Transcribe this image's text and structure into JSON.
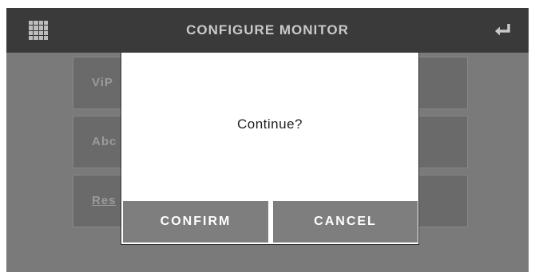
{
  "header": {
    "title": "CONFIGURE MONITOR",
    "menu_icon": "grid-menu-icon",
    "back_icon": "return-arrow-icon"
  },
  "menu": {
    "items": [
      {
        "label": "ViP"
      },
      {
        "label": "Abc"
      },
      {
        "label": "Res"
      }
    ]
  },
  "dialog": {
    "message": "Continue?",
    "confirm_label": "CONFIRM",
    "cancel_label": "CANCEL"
  },
  "colors": {
    "background": "#7a7a7a",
    "header": "#3a3a3a",
    "button": "#7e7e7e",
    "dialog": "#ffffff"
  }
}
